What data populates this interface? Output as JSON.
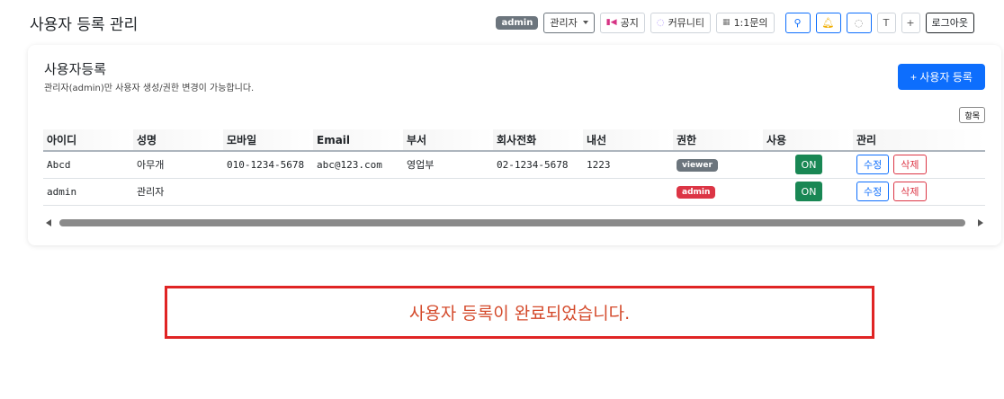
{
  "header": {
    "title": "사용자 등록 관리",
    "role_badge": "admin",
    "role_select": "관리자",
    "notice_label": "공지",
    "community_label": "커뮤니티",
    "inquiry_label": "1:1문의",
    "theme_label": "T",
    "plus_label": "+",
    "logout_label": "로그아웃",
    "icons": [
      "notice-icon",
      "community-icon",
      "inquiry-icon",
      "search-icon",
      "bell-icon",
      "chat-icon"
    ]
  },
  "card": {
    "title": "사용자등록",
    "subtitle": "관리자(admin)만 사용자 생성/권한 변경이 가능합니다.",
    "add_button": "+ 사용자 등록",
    "columns_button": "항목"
  },
  "table": {
    "headers": [
      "아이디",
      "성명",
      "모바일",
      "Email",
      "부서",
      "회사전화",
      "내선",
      "권한",
      "사용",
      "관리"
    ],
    "rows": [
      {
        "id": "Abcd",
        "name": "아무개",
        "mobile": "010-1234-5678",
        "email": "abc@123.com",
        "dept": "영업부",
        "phone": "02-1234-5678",
        "ext": "1223",
        "role": "viewer",
        "role_color": "#6c757d",
        "use": "ON",
        "edit": "수정",
        "delete": "삭제"
      },
      {
        "id": "admin",
        "name": "관리자",
        "mobile": "",
        "email": "",
        "dept": "",
        "phone": "",
        "ext": "",
        "role": "admin",
        "role_color": "#dc3545",
        "use": "ON",
        "edit": "수정",
        "delete": "삭제"
      }
    ]
  },
  "message": "사용자 등록이 완료되었습니다.",
  "colors": {
    "primary": "#0d6efd",
    "success": "#198754",
    "danger": "#dc3545",
    "alert_border": "#e02424"
  }
}
